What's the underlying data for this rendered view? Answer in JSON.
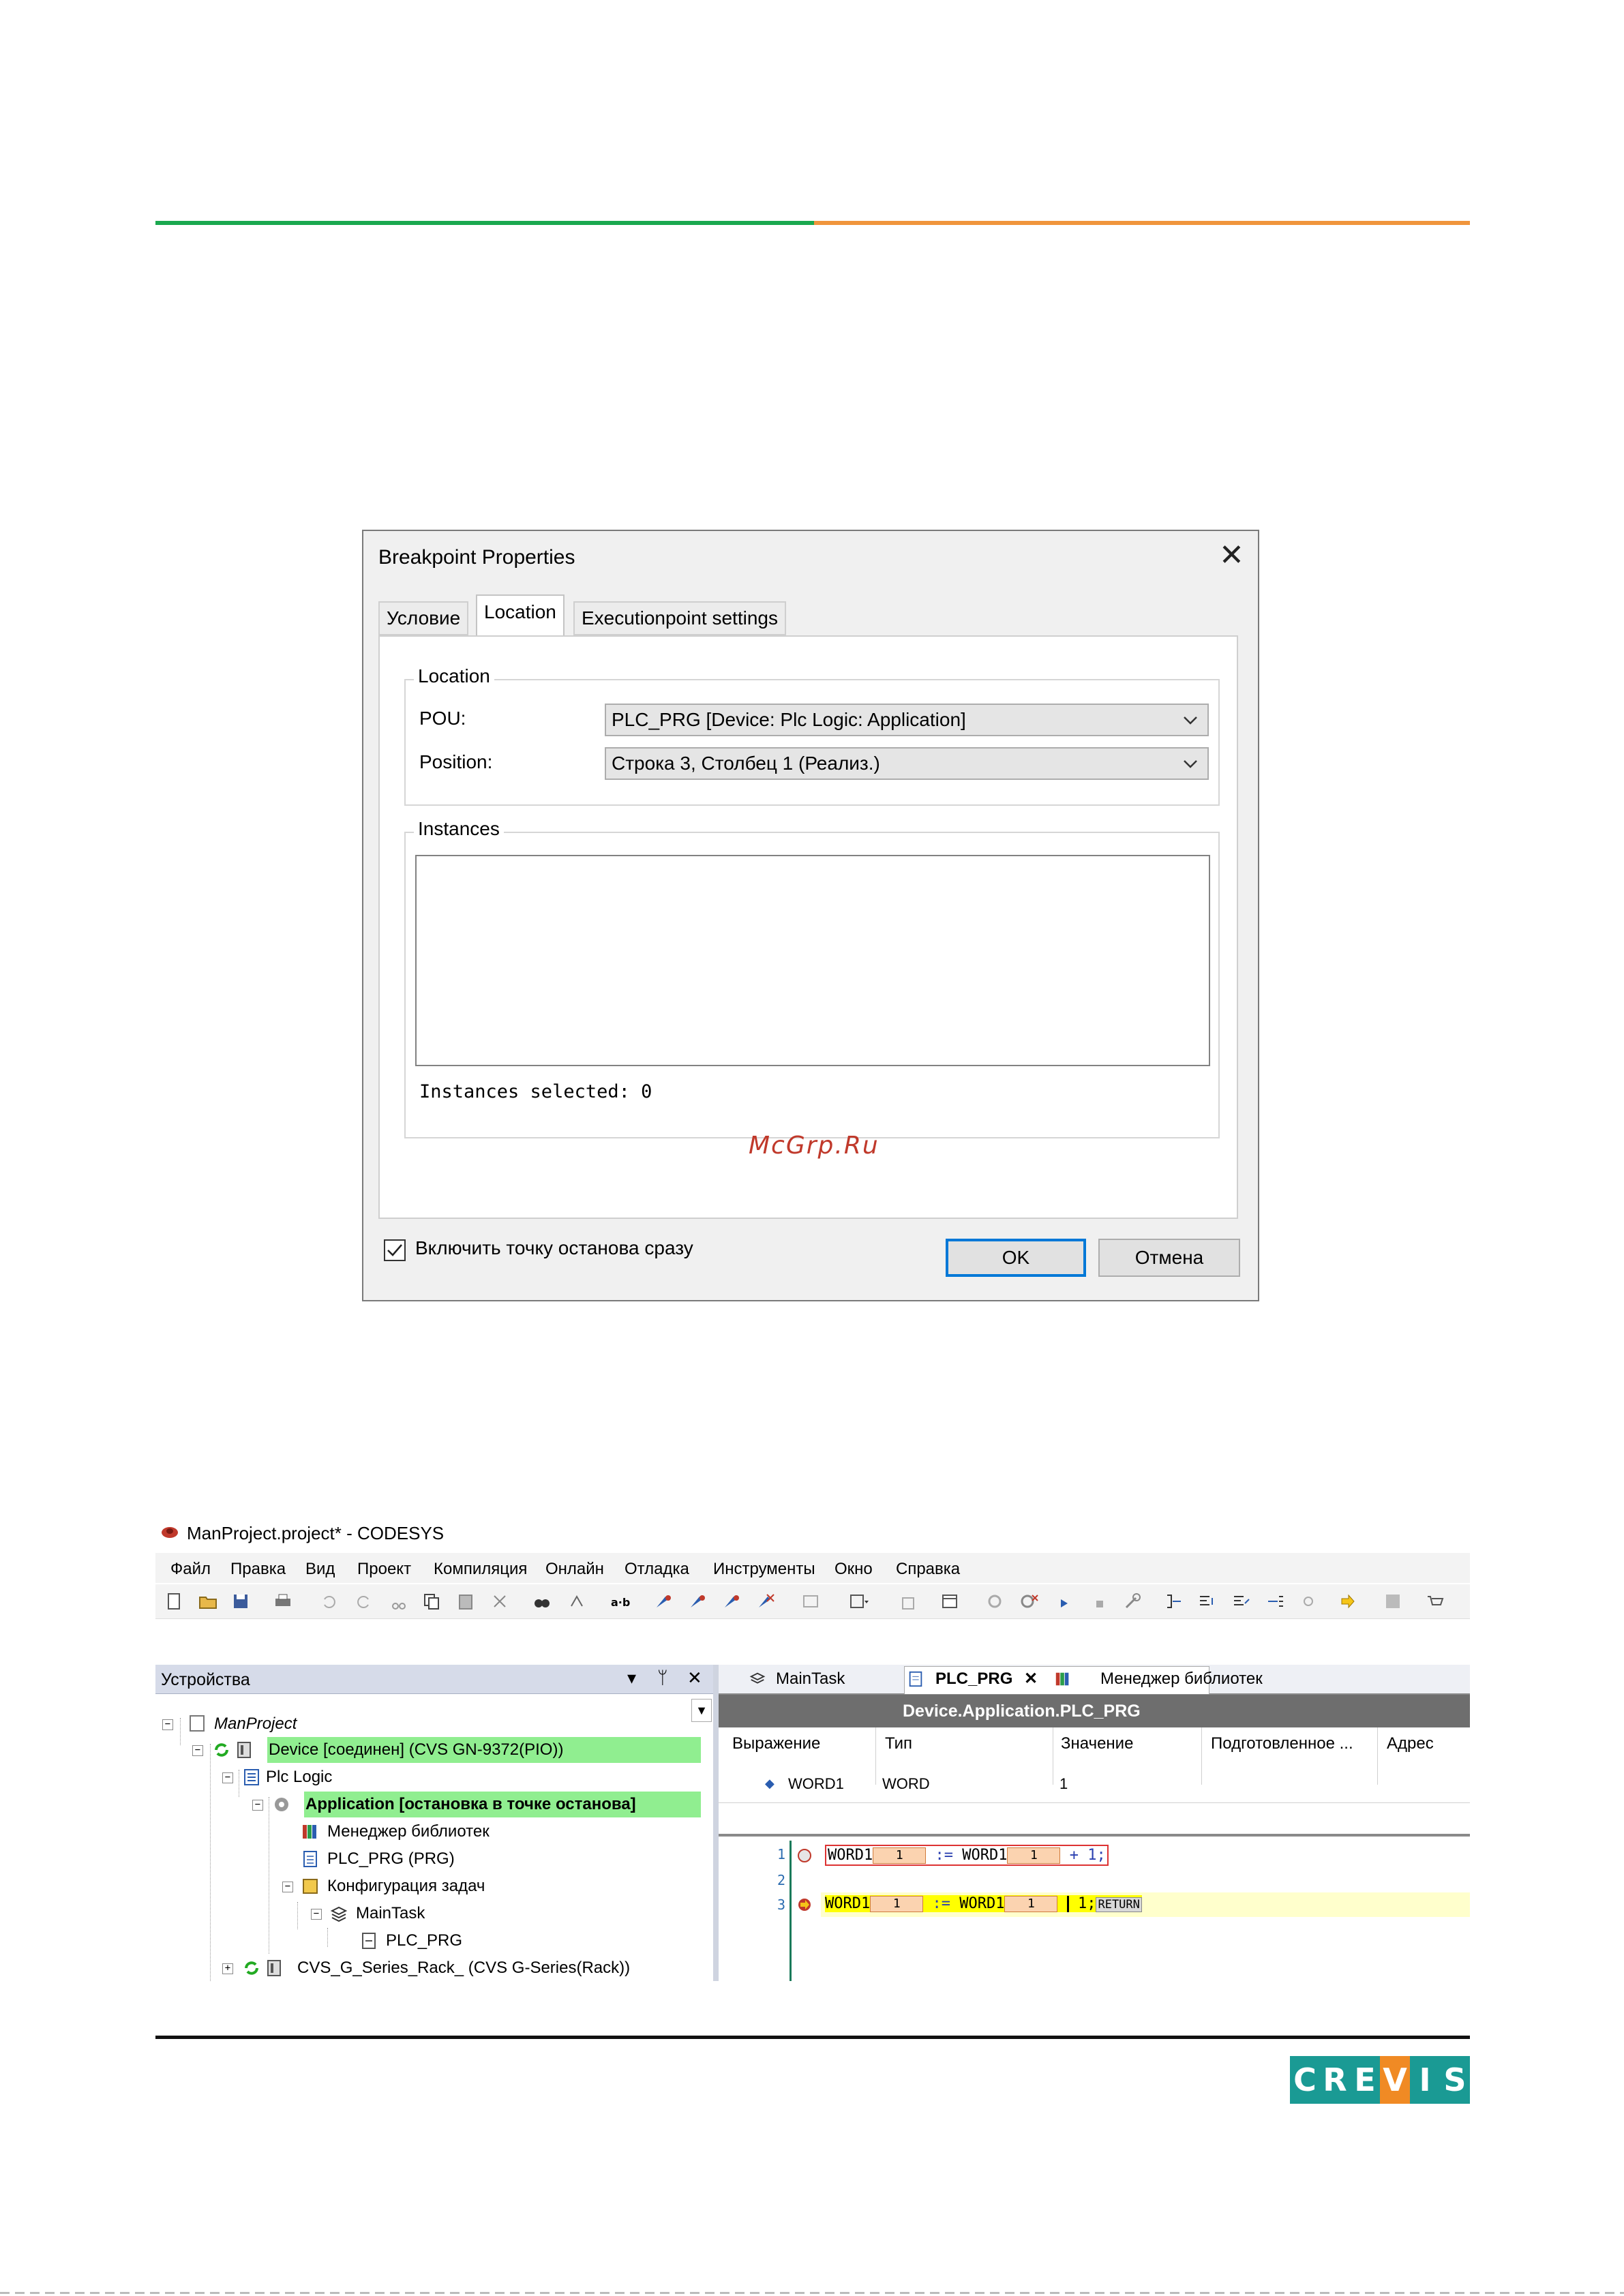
{
  "dialog": {
    "title": "Breakpoint Properties",
    "tabs": [
      "Условие",
      "Location",
      "Executionpoint settings"
    ],
    "location_group": "Location",
    "pou_label": "POU:",
    "pou_value": "PLC_PRG [Device: Plc Logic: Application]",
    "position_label": "Position:",
    "position_value": "Строка 3, Столбец 1 (Реализ.)",
    "instances_group": "Instances",
    "instances_selected": "Instances selected: 0",
    "enable_checkbox_label": "Включить точку останова сразу",
    "enable_checked": true,
    "ok_label": "OK",
    "cancel_label": "Отмена"
  },
  "watermark": "McGrp.Ru",
  "ide": {
    "title": "ManProject.project* - CODESYS",
    "menu": [
      "Файл",
      "Правка",
      "Вид",
      "Проект",
      "Компиляция",
      "Онлайн",
      "Отладка",
      "Инструменты",
      "Окно",
      "Справка"
    ],
    "devices_pane": {
      "title": "Устройства",
      "tree": [
        {
          "label": "ManProject",
          "italic": true,
          "highlight": false
        },
        {
          "label": "Device [соединен] (CVS GN-9372(PIO))",
          "highlight": true
        },
        {
          "label": "Plc Logic",
          "highlight": false
        },
        {
          "label": "Application [остановка в точке останова]",
          "highlight": true,
          "bold": true
        },
        {
          "label": "Менеджер библиотек",
          "highlight": false
        },
        {
          "label": "PLC_PRG (PRG)",
          "highlight": false
        },
        {
          "label": "Конфигурация задач",
          "highlight": false
        },
        {
          "label": "MainTask",
          "highlight": false
        },
        {
          "label": "PLC_PRG",
          "highlight": false
        },
        {
          "label": "CVS_G_Series_Rack_ (CVS G-Series(Rack))",
          "highlight": false
        }
      ]
    },
    "editor_tabs": [
      "MainTask",
      "PLC_PRG",
      "Менеджер библиотек"
    ],
    "editor_path": "Device.Application.PLC_PRG",
    "columns": [
      "Выражение",
      "Тип",
      "Значение",
      "Подготовленное ...",
      "Адрес"
    ],
    "variable": {
      "name": "WORD1",
      "type": "WORD",
      "value": "1"
    },
    "code": {
      "line_numbers": [
        "1",
        "2",
        "3"
      ],
      "var": "WORD1",
      "monitor_value": "1",
      "assign": ":=",
      "plus_one": "+ 1;",
      "semicolon_tail": "1;",
      "return_label": "RETURN"
    }
  },
  "logo_letters": [
    "C",
    "R",
    "E",
    "V",
    "I",
    "S"
  ],
  "colors": {
    "header_green": "#1aa84f",
    "header_orange": "#f0953c",
    "logo_teal": "#1a9a94",
    "logo_orange": "#f08a24",
    "tree_highlight": "#90ee90",
    "current_line": "#ffff00"
  }
}
